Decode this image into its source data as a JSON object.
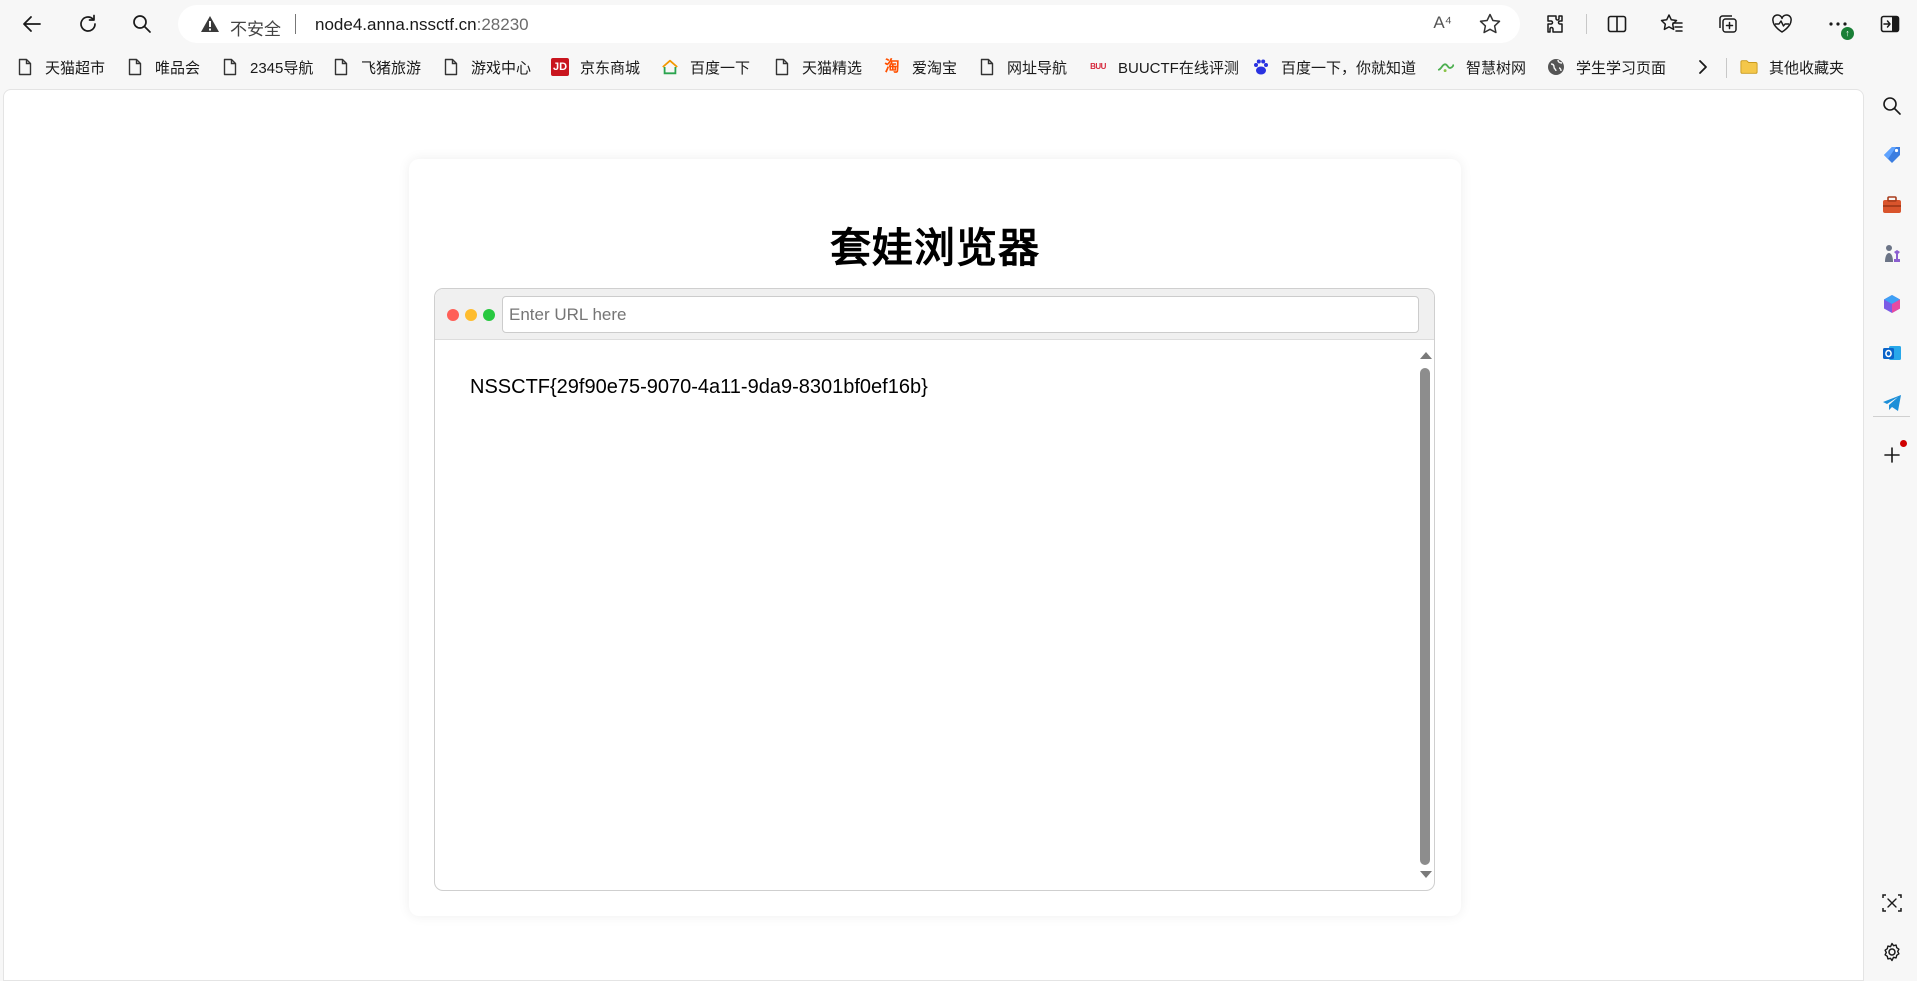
{
  "address_bar": {
    "security_label": "不安全",
    "url_host": "node4.anna.nssctf.cn",
    "url_port": ":28230",
    "read_aloud_glyph": "A⁴"
  },
  "toolbar": {
    "icons": [
      "back-icon",
      "refresh-icon",
      "search-icon",
      "warning-icon",
      "read-aloud-icon",
      "favorite-star-icon",
      "extensions-icon",
      "split-screen-icon",
      "favorites-icon",
      "collections-icon",
      "browser-essentials-icon",
      "more-icon",
      "sidebar-toggle-icon"
    ]
  },
  "bookmarks": [
    {
      "label": "天猫超市",
      "icon": "page-icon"
    },
    {
      "label": "唯品会",
      "icon": "page-icon"
    },
    {
      "label": "2345导航",
      "icon": "page-icon"
    },
    {
      "label": "飞猪旅游",
      "icon": "page-icon"
    },
    {
      "label": "游戏中心",
      "icon": "page-icon"
    },
    {
      "label": "京东商城",
      "icon": "jd-icon",
      "icon_text": "JD"
    },
    {
      "label": "百度一下",
      "icon": "2345-house-icon"
    },
    {
      "label": "天猫精选",
      "icon": "page-icon"
    },
    {
      "label": "爱淘宝",
      "icon": "taobao-icon",
      "icon_text": "淘"
    },
    {
      "label": "网址导航",
      "icon": "page-icon"
    },
    {
      "label": "BUUCTF在线评测",
      "icon": "buuctf-icon",
      "icon_text": "BUU"
    },
    {
      "label": "百度一下，你就知道",
      "icon": "baidu-paw-icon"
    },
    {
      "label": "智慧树网",
      "icon": "zhihuishu-icon"
    },
    {
      "label": "学生学习页面",
      "icon": "globe-icon"
    },
    {
      "label": "其他收藏夹",
      "icon": "folder-icon"
    }
  ],
  "page": {
    "title": "套娃浏览器",
    "url_placeholder": "Enter URL here",
    "content_text": "NSSCTF{29f90e75-9070-4a11-9da9-8301bf0ef16b}"
  },
  "colors": {
    "dot_red": "#ff5f57",
    "dot_yellow": "#febc2e",
    "dot_green": "#28c840",
    "badge_green": "#1a7f37",
    "notification_red": "#d00000"
  },
  "sidebar": {
    "icons": [
      "search-icon",
      "shopping-tag-icon",
      "tools-icon",
      "chess-icon",
      "copilot-icon",
      "outlook-icon",
      "telegram-icon",
      "add-icon",
      "screenshot-icon",
      "settings-icon"
    ]
  }
}
